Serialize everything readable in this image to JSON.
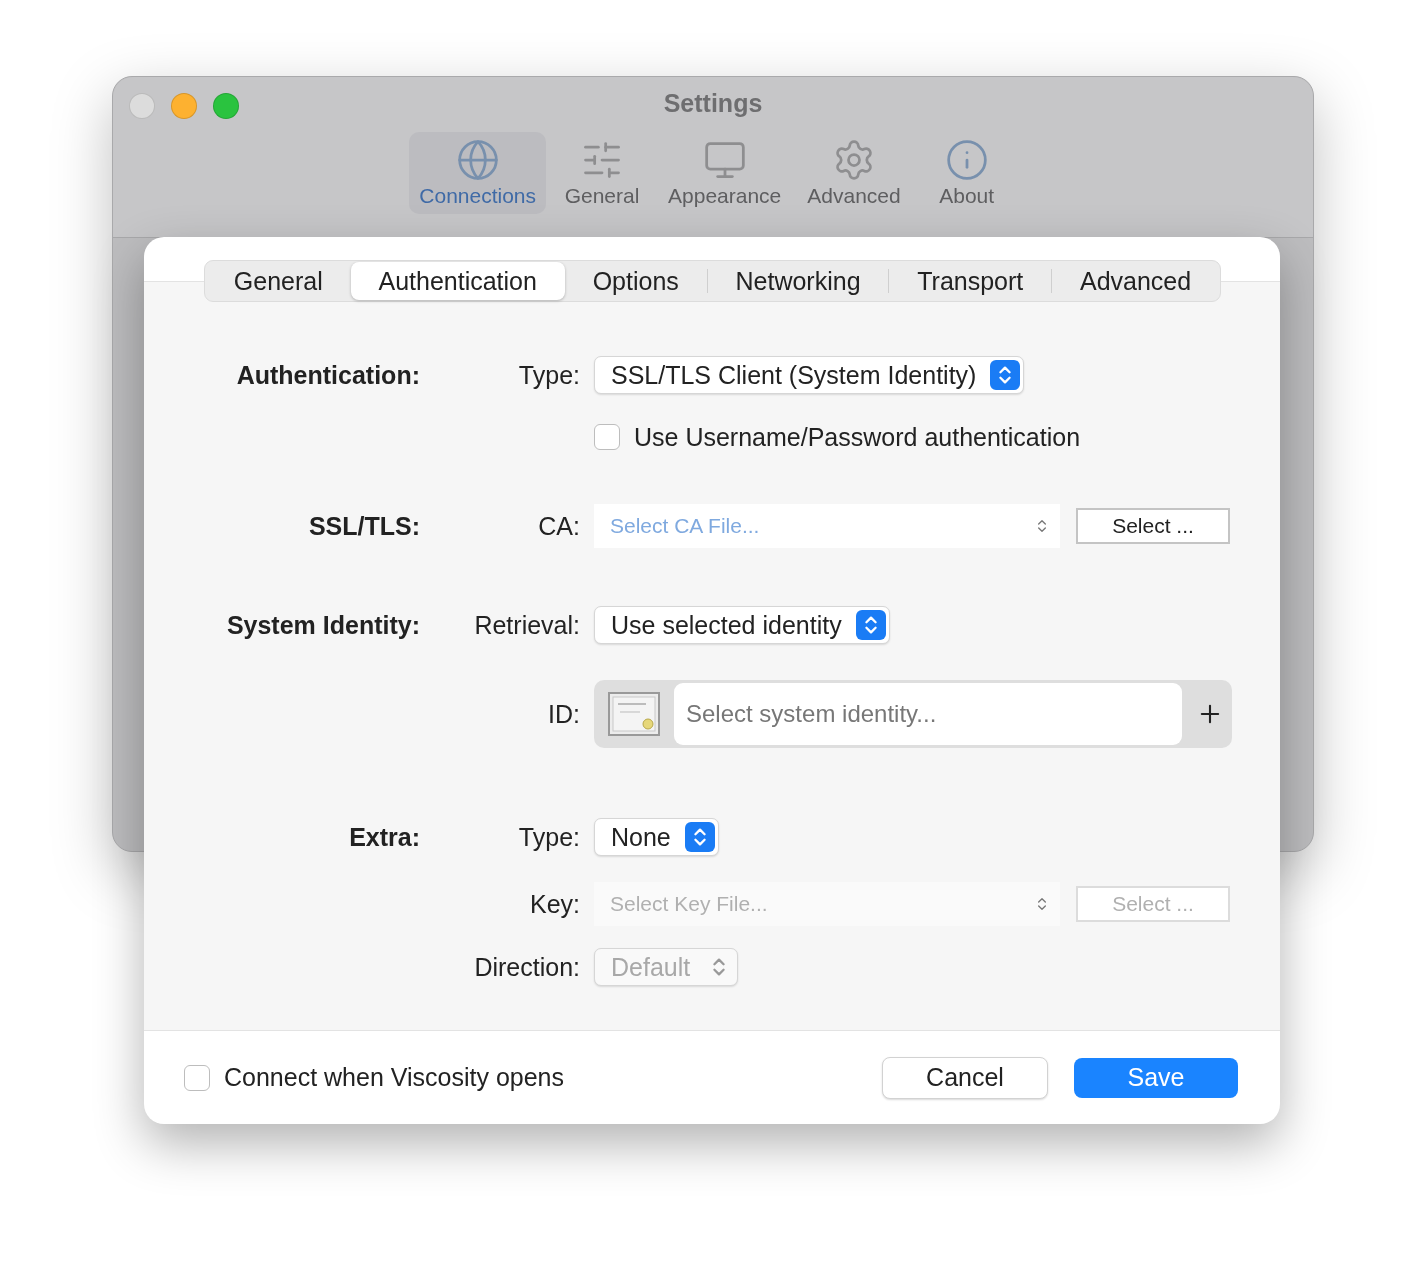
{
  "window": {
    "title": "Settings"
  },
  "toolbar": [
    {
      "label": "Connections",
      "selected": true
    },
    {
      "label": "General",
      "selected": false
    },
    {
      "label": "Appearance",
      "selected": false
    },
    {
      "label": "Advanced",
      "selected": false
    },
    {
      "label": "About",
      "selected": false
    }
  ],
  "sheet": {
    "tabs": [
      {
        "label": "General",
        "selected": false
      },
      {
        "label": "Authentication",
        "selected": true
      },
      {
        "label": "Options",
        "selected": false
      },
      {
        "label": "Networking",
        "selected": false
      },
      {
        "label": "Transport",
        "selected": false
      },
      {
        "label": "Advanced",
        "selected": false
      }
    ],
    "rows": [
      {
        "kind": "popup",
        "section": "Authentication:",
        "label": "Type:",
        "value": "SSL/TLS Client (System Identity)",
        "disabled": false
      },
      {
        "kind": "checkbox",
        "label": "Use Username/Password authentication",
        "checked": false
      },
      {
        "kind": "file",
        "section": "SSL/TLS:",
        "label": "CA:",
        "placeholder": "Select CA File...",
        "button": "Select ...",
        "disabled": false
      },
      {
        "kind": "popup",
        "section": "System Identity:",
        "label": "Retrieval:",
        "value": "Use selected identity",
        "disabled": false
      },
      {
        "kind": "identity",
        "label": "ID:",
        "placeholder": "Select system identity..."
      },
      {
        "kind": "popup",
        "section": "Extra:",
        "label": "Type:",
        "value": "None",
        "disabled": false
      },
      {
        "kind": "file",
        "label": "Key:",
        "placeholder": "Select Key File...",
        "button": "Select ...",
        "disabled": true
      },
      {
        "kind": "popup",
        "label": "Direction:",
        "value": "Default",
        "disabled": true
      }
    ],
    "footer": {
      "checkbox": {
        "label": "Connect when Viscosity opens",
        "checked": false
      },
      "cancel": "Cancel",
      "save": "Save"
    }
  }
}
